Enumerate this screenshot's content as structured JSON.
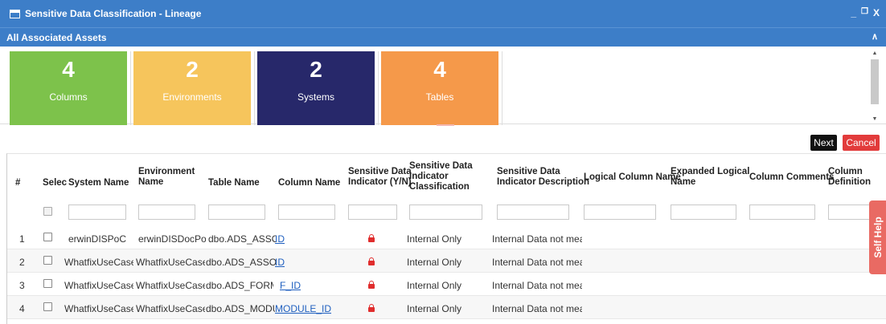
{
  "window": {
    "title": "Sensitive Data Classification - Lineage",
    "controls": [
      "_",
      "❐",
      "X"
    ]
  },
  "section": {
    "title": "All Associated Assets",
    "caret": "∧"
  },
  "tiles": [
    {
      "count": "4",
      "label": "Columns",
      "color": "#7dc24b"
    },
    {
      "count": "2",
      "label": "Environments",
      "color": "#f6c55c"
    },
    {
      "count": "2",
      "label": "Systems",
      "color": "#27286a"
    },
    {
      "count": "4",
      "label": "Tables",
      "color": "#f5994a"
    }
  ],
  "actions": {
    "next": "Next",
    "cancel": "Cancel"
  },
  "table": {
    "headers": {
      "num": "#",
      "select": "Selec",
      "system": "System Name",
      "environment": [
        "Environment",
        "Name"
      ],
      "table": "Table Name",
      "column": "Column Name",
      "indicator": [
        "Sensitive Data",
        "Indicator (Y/N)"
      ],
      "classification": [
        "Sensitive Data",
        "Indicator",
        "Classification"
      ],
      "description": [
        "Sensitive Data",
        "Indicator Description"
      ],
      "logical": "Logical Column Name",
      "expanded": [
        "Expanded Logical",
        "Name"
      ],
      "comments": "Column Comments",
      "definition": [
        "Column",
        "Definition"
      ]
    },
    "rows": [
      {
        "num": "1",
        "system": "erwinDISPoC",
        "environment": "erwinDISDocPoC",
        "table": "dbo.ADS_ASSOCIA",
        "column": "ID",
        "classification": "Internal Only",
        "description": "Internal Data not meant fi"
      },
      {
        "num": "2",
        "system": "WhatfixUseCase",
        "environment": "WhatfixUseCase",
        "table": "dbo.ADS_ASSOCIA",
        "column": "ID",
        "classification": "Internal Only",
        "description": "Internal Data not meant fi"
      },
      {
        "num": "3",
        "system": "WhatfixUseCase",
        "environment": "WhatfixUseCase",
        "table": "dbo.ADS_FORM",
        "column": "F_ID",
        "classification": "Internal Only",
        "description": "Internal Data not meant fi"
      },
      {
        "num": "4",
        "system": "WhatfixUseCase",
        "environment": "WhatfixUseCase",
        "table": "dbo.ADS_MODULE",
        "column": "MODULE_ID",
        "classification": "Internal Only",
        "description": "Internal Data not meant fi"
      }
    ]
  },
  "self_help": "Self Help"
}
